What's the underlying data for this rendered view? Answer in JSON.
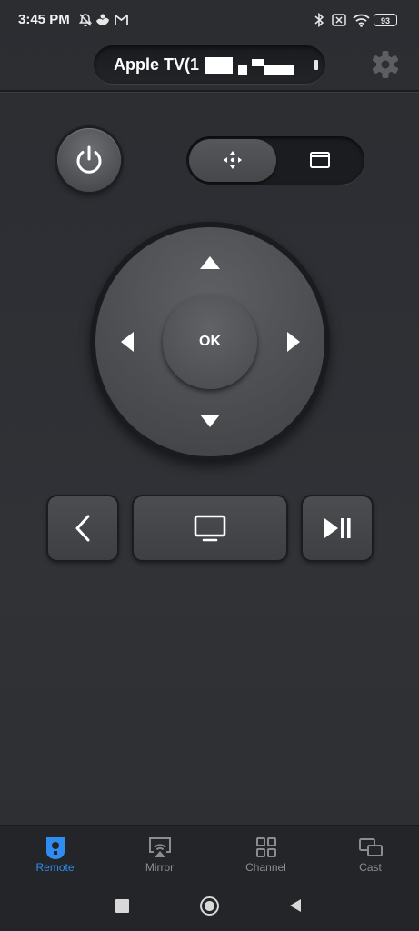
{
  "status_bar": {
    "time": "3:45 PM",
    "battery": "93",
    "left_icons": [
      "bell-off-icon",
      "cloud-bird-icon",
      "gmail-icon"
    ],
    "right_icons": [
      "bluetooth-icon",
      "no-sim-icon",
      "wifi-icon",
      "battery-icon"
    ]
  },
  "header": {
    "device_name": "Apple TV(1",
    "settings_icon": "gear-icon"
  },
  "remote": {
    "power_icon": "power-icon",
    "modes": [
      {
        "icon": "dpad-move-icon",
        "active": true
      },
      {
        "icon": "touchpad-icon",
        "active": false
      }
    ],
    "ok_label": "OK",
    "back_icon": "chevron-left-icon",
    "home_icon": "tv-icon",
    "play_pause_icon": "play-pause-icon"
  },
  "bottom_nav": {
    "items": [
      {
        "label": "Remote",
        "icon": "remote-icon",
        "active": true
      },
      {
        "label": "Mirror",
        "icon": "airplay-icon",
        "active": false
      },
      {
        "label": "Channel",
        "icon": "grid-icon",
        "active": false
      },
      {
        "label": "Cast",
        "icon": "cast-icon",
        "active": false
      }
    ]
  },
  "colors": {
    "accent": "#2f8cf0",
    "background": "#2d2f34",
    "button": "#4b4d51",
    "inactive_label": "#8b8d91"
  }
}
